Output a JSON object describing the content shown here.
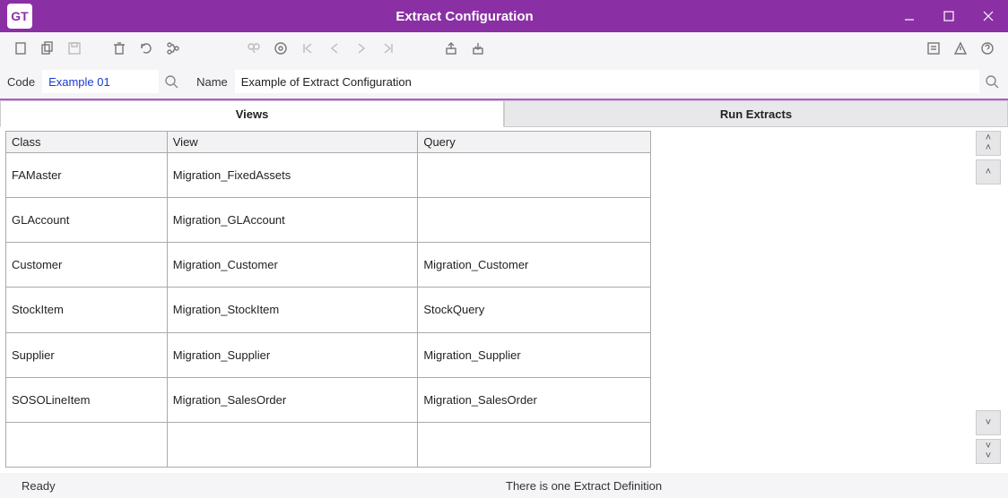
{
  "window": {
    "title": "Extract Configuration",
    "app_abbrev": "GT"
  },
  "form": {
    "code_label": "Code",
    "code_value": "Example 01",
    "name_label": "Name",
    "name_value": "Example of Extract Configuration"
  },
  "tabs": {
    "views": "Views",
    "run": "Run Extracts"
  },
  "columns": {
    "class": "Class",
    "view": "View",
    "query": "Query"
  },
  "rows": [
    {
      "class": "FAMaster",
      "view": "Migration_FixedAssets",
      "query": ""
    },
    {
      "class": "GLAccount",
      "view": "Migration_GLAccount",
      "query": ""
    },
    {
      "class": "Customer",
      "view": "Migration_Customer",
      "query": "Migration_Customer"
    },
    {
      "class": "StockItem",
      "view": "Migration_StockItem",
      "query": "StockQuery"
    },
    {
      "class": "Supplier",
      "view": "Migration_Supplier",
      "query": "Migration_Supplier"
    },
    {
      "class": "SOSOLineItem",
      "view": "Migration_SalesOrder",
      "query": "Migration_SalesOrder"
    },
    {
      "class": "",
      "view": "",
      "query": ""
    }
  ],
  "side": {
    "top": "˄",
    "up": "˄",
    "down": "˅",
    "bottom": "˅"
  },
  "status": {
    "left": "Ready",
    "center": "There is one Extract Definition"
  }
}
